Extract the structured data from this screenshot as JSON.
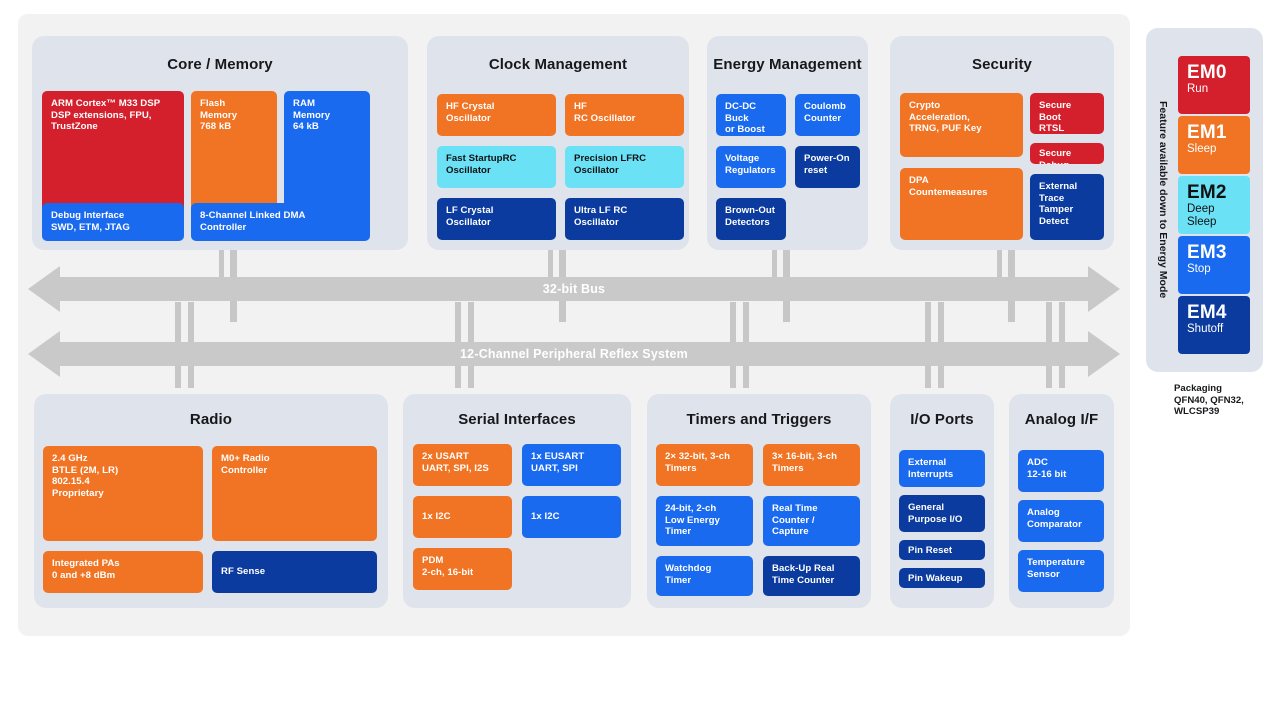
{
  "colors": {
    "red": "#d41f2c",
    "orange": "#f07423",
    "blue": "#1a6af0",
    "navy": "#0b3b9e",
    "cyan": "#6ae1f5",
    "panel": "#dfe3eb",
    "canvas": "#f2f2f2",
    "bus": "#c9c9c9"
  },
  "groups": {
    "core_memory": {
      "title": "Core / Memory",
      "blocks": [
        {
          "label": "ARM Cortex™ M33 DSP\nDSP extensions, FPU,\nTrustZone",
          "color": "red"
        },
        {
          "label": "Flash\nMemory\n768 kB",
          "color": "orange"
        },
        {
          "label": "RAM\nMemory\n64 kB",
          "color": "blue"
        },
        {
          "label": "Debug Interface\nSWD, ETM, JTAG",
          "color": "blue"
        },
        {
          "label": "8-Channel Linked DMA\nController",
          "color": "blue"
        }
      ]
    },
    "clock_management": {
      "title": "Clock Management",
      "blocks": [
        {
          "label": "HF Crystal\nOscillator",
          "color": "orange"
        },
        {
          "label": "HF\nRC Oscillator",
          "color": "orange"
        },
        {
          "label": "Fast StartupRC\nOscillator",
          "color": "cyan"
        },
        {
          "label": "Precision LFRC\nOscillator",
          "color": "cyan"
        },
        {
          "label": "LF Crystal\nOscillator",
          "color": "navy"
        },
        {
          "label": "Ultra LF RC\nOscillator",
          "color": "navy"
        }
      ]
    },
    "energy_management": {
      "title": "Energy Management",
      "blocks": [
        {
          "label": "DC-DC Buck\nor Boost",
          "color": "blue"
        },
        {
          "label": "Coulomb\nCounter",
          "color": "blue"
        },
        {
          "label": "Voltage\nRegulators",
          "color": "blue"
        },
        {
          "label": "Power-On\nreset",
          "color": "navy"
        },
        {
          "label": "Brown-Out\nDetectors",
          "color": "navy"
        }
      ]
    },
    "security": {
      "title": "Security",
      "blocks": [
        {
          "label": "Crypto\nAcceleration,\nTRNG, PUF Key",
          "color": "orange"
        },
        {
          "label": "Secure Boot\nRTSL",
          "color": "red"
        },
        {
          "label": "Secure Debug",
          "color": "red"
        },
        {
          "label": "DPA\nCountemeasures",
          "color": "orange"
        },
        {
          "label": "External Trace\nTamper Detect",
          "color": "navy"
        }
      ]
    },
    "radio": {
      "title": "Radio",
      "blocks": [
        {
          "label": "2.4 GHz\nBTLE (2M, LR)\n802.15.4\nProprietary",
          "color": "orange"
        },
        {
          "label": "M0+ Radio\nController",
          "color": "orange"
        },
        {
          "label": "Integrated PAs\n0 and +8 dBm",
          "color": "orange"
        },
        {
          "label": "RF Sense",
          "color": "navy"
        }
      ]
    },
    "serial_interfaces": {
      "title": "Serial Interfaces",
      "blocks": [
        {
          "label": "2x USART\nUART, SPI, I2S",
          "color": "orange"
        },
        {
          "label": "1x EUSART\nUART, SPI",
          "color": "blue"
        },
        {
          "label": "1x I2C",
          "color": "orange"
        },
        {
          "label": "1x I2C",
          "color": "blue"
        },
        {
          "label": "PDM\n2-ch, 16-bit",
          "color": "orange"
        }
      ]
    },
    "timers_triggers": {
      "title": "Timers and Triggers",
      "blocks": [
        {
          "label": "2× 32-bit, 3-ch\nTimers",
          "color": "orange"
        },
        {
          "label": "3× 16-bit, 3-ch\nTimers",
          "color": "orange"
        },
        {
          "label": "24-bit, 2-ch\nLow Energy\nTimer",
          "color": "blue"
        },
        {
          "label": "Real Time\nCounter /\nCapture",
          "color": "blue"
        },
        {
          "label": "Watchdog\nTimer",
          "color": "blue"
        },
        {
          "label": "Back-Up Real\nTime Counter",
          "color": "navy"
        }
      ]
    },
    "io_ports": {
      "title": "I/O Ports",
      "blocks": [
        {
          "label": "External\nInterrupts",
          "color": "blue"
        },
        {
          "label": "General\nPurpose I/O",
          "color": "navy"
        },
        {
          "label": "Pin Reset",
          "color": "navy"
        },
        {
          "label": "Pin Wakeup",
          "color": "navy"
        }
      ]
    },
    "analog_if": {
      "title": "Analog I/F",
      "blocks": [
        {
          "label": "ADC\n12-16 bit",
          "color": "blue"
        },
        {
          "label": "Analog\nComparator",
          "color": "blue"
        },
        {
          "label": "Temperature\nSensor",
          "color": "blue"
        }
      ]
    }
  },
  "buses": {
    "top": {
      "label": "32-bit Bus"
    },
    "bottom": {
      "label": "12-Channel Peripheral Reflex System"
    }
  },
  "energy_modes": {
    "vertical_label": "Feature available down to Energy Mode",
    "modes": [
      {
        "code": "EM0",
        "name": "Run",
        "color": "red"
      },
      {
        "code": "EM1",
        "name": "Sleep",
        "color": "orange"
      },
      {
        "code": "EM2",
        "name": "Deep\nSleep",
        "color": "cyan"
      },
      {
        "code": "EM3",
        "name": "Stop",
        "color": "blue"
      },
      {
        "code": "EM4",
        "name": "Shutoff",
        "color": "navy"
      }
    ]
  },
  "packaging": {
    "text": "Packaging\nQFN40, QFN32,\nWLCSP39"
  }
}
